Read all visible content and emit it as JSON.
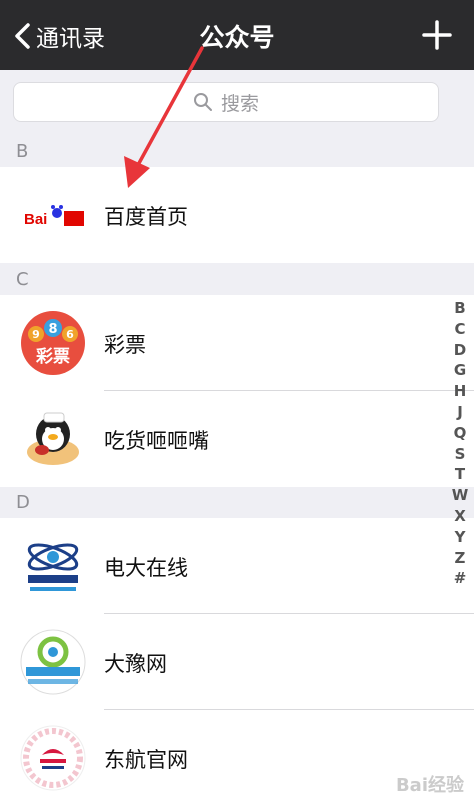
{
  "nav": {
    "back_label": "通讯录",
    "title": "公众号"
  },
  "search": {
    "placeholder": "搜索"
  },
  "sections": [
    {
      "letter": "B",
      "items": [
        {
          "name": "百度首页",
          "icon": "baidu-logo"
        }
      ]
    },
    {
      "letter": "C",
      "items": [
        {
          "name": "彩票",
          "icon": "lottery-logo",
          "logo_text": "彩票",
          "logo_digits": "986"
        },
        {
          "name": "吃货咂咂嘴",
          "icon": "foodie-penguin-logo"
        }
      ]
    },
    {
      "letter": "D",
      "items": [
        {
          "name": "电大在线",
          "icon": "dianda-logo"
        },
        {
          "name": "大豫网",
          "icon": "dayu-logo"
        },
        {
          "name": "东航官网",
          "icon": "china-eastern-logo"
        }
      ]
    }
  ],
  "index_letters": [
    "B",
    "C",
    "D",
    "G",
    "H",
    "J",
    "Q",
    "S",
    "T",
    "W",
    "X",
    "Y",
    "Z",
    "#"
  ],
  "colors": {
    "nav_bg": "#2b2b2d",
    "arrow": "#e8353a",
    "lottery": "#e84e3e"
  }
}
